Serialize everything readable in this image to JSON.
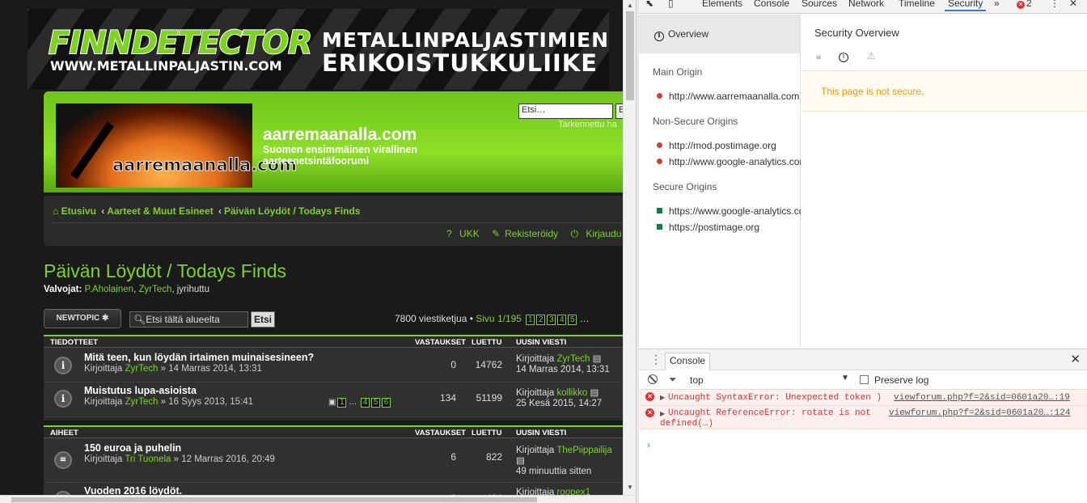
{
  "banner": {
    "brand": "FINNDETECTOR",
    "url": "WWW.METALLINPALJASTIN.COM",
    "tagline_1": "METALLINPALJASTIMIEN",
    "tagline_2": "ERIKOISTUKKULIIKE"
  },
  "header": {
    "logo_text": "aarremaanalla.com",
    "site_title": "aarremaanalla.com",
    "site_desc": "Suomen ensimmäinen virallinen aarteenetsintäfoorumi",
    "search_placeholder": "Etsi…",
    "search_btn": "E",
    "advanced": "Tarkennettu ha"
  },
  "nav": {
    "crumbs": [
      "Etusivu",
      "Aarteet & Muut Esineet",
      "Päivän Löydöt / Todays Finds"
    ],
    "crumb_sep": "‹",
    "ukk": "UKK",
    "register": "Rekisteröidy",
    "login": "Kirjaudu sis"
  },
  "forum": {
    "title": "Päivän Löydöt / Todays Finds",
    "mods_label": "Valvojat:",
    "mods": [
      "P.Aholainen",
      "ZyrTech",
      "jyrihuttu"
    ],
    "newtopic": "NEWTOPIC",
    "search_placeholder": "Etsi tältä alueelta",
    "search_btn": "Etsi",
    "topic_count": "7800 viestiketjua",
    "page_label": "Sivu 1/195",
    "pages": [
      "1",
      "2",
      "3",
      "4",
      "5"
    ],
    "ellipsis": "…"
  },
  "announcements": {
    "header": "TIEDOTTEET",
    "col_replies": "VASTAUKSET",
    "col_views": "LUETTU",
    "col_last": "UUSIN VIESTI",
    "rows": [
      {
        "title": "Mitä teen, kun löydän irtaimen muinaisesineen?",
        "by": "Kirjoittaja",
        "author": "ZyrTech",
        "date": "» 14 Marras 2014, 13:31",
        "replies": "0",
        "views": "14762",
        "last_by": "Kirjoittaja",
        "last_author": "ZyrTech",
        "last_date": "14 Marras 2014, 13:31"
      },
      {
        "title": "Muistutus lupa-asioista",
        "by": "Kirjoittaja",
        "author": "ZyrTech",
        "date": "» 16 Syys 2013, 15:41",
        "replies": "134",
        "views": "51199",
        "last_by": "Kirjoittaja",
        "last_author": "kollikko",
        "last_date": "25 Kesä 2015, 14:27",
        "mini_pages": [
          "1",
          "…",
          "4",
          "5",
          "6"
        ]
      }
    ]
  },
  "topics": {
    "header": "AIHEET",
    "col_replies": "VASTAUKSET",
    "col_views": "LUETTU",
    "col_last": "UUSIN VIESTI",
    "rows": [
      {
        "title": "150 euroa ja puhelin",
        "by": "Kirjoittaja",
        "author": "Tri Tuonela",
        "date": "» 12 Marras 2016, 20:49",
        "replies": "6",
        "views": "822",
        "last_by": "Kirjoittaja",
        "last_author": "ThePiippailija",
        "last_date": "49 minuuttia sitten"
      },
      {
        "title": "Vuoden 2016 löydöt.",
        "by": "Kirjoittaja",
        "author": "",
        "date": "",
        "replies": "8",
        "views": "464",
        "last_by": "Kirjoittaja",
        "last_author": "roopex1",
        "last_date": ""
      }
    ]
  },
  "devtools": {
    "tabs": [
      "Elements",
      "Console",
      "Sources",
      "Network",
      "Timeline",
      "Security"
    ],
    "more": "»",
    "error_count": "2",
    "overview": "Overview",
    "main_origin_h": "Main Origin",
    "main_origin": "http://www.aarremaanalla.com",
    "nonsecure_h": "Non-Secure Origins",
    "nonsecure": [
      "http://mod.postimage.org",
      "http://www.google-analytics.com"
    ],
    "secure_h": "Secure Origins",
    "secure": [
      "https://www.google-analytics.com",
      "https://postimage.org"
    ],
    "overview_title": "Security Overview",
    "not_secure": "This page is not secure.",
    "console_tab": "Console",
    "context": "top",
    "preserve": "Preserve log",
    "errors": [
      {
        "text": "Uncaught SyntaxError: Unexpected token )",
        "src": "viewforum.php?f=2&sid=0601a20…:19"
      },
      {
        "text": "Uncaught ReferenceError: rotate is not",
        "text2": "defined(…)",
        "src": "viewforum.php?f=2&sid=0601a20…:124"
      }
    ],
    "prompt": "›"
  }
}
